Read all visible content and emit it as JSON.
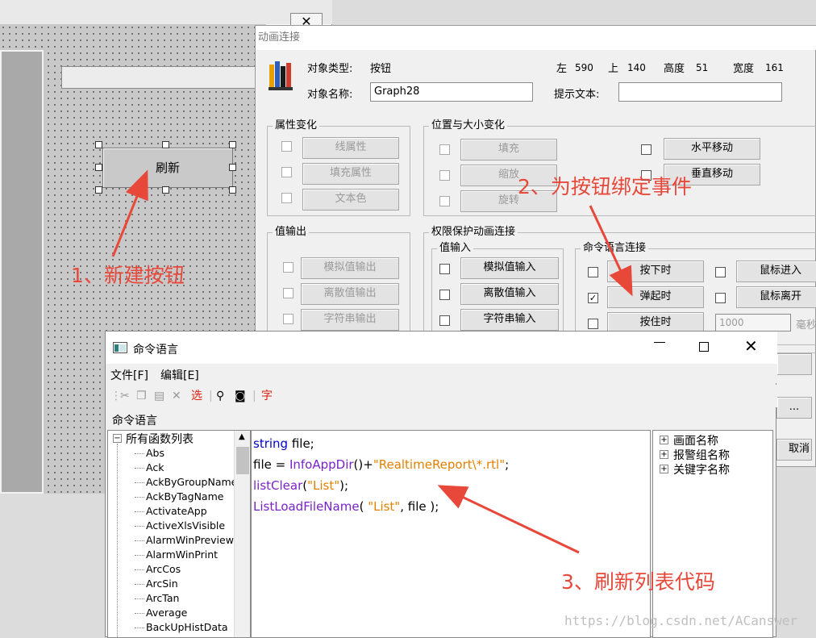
{
  "anim_dialog": {
    "title": "动画连接",
    "object_type_label": "对象类型:",
    "object_type_value": "按钮",
    "left_label": "左",
    "left_value": "590",
    "top_label": "上",
    "top_value": "140",
    "height_label": "高度",
    "height_value": "51",
    "width_label": "宽度",
    "width_value": "161",
    "object_name_label": "对象名称:",
    "object_name_value": "Graph28",
    "tooltip_label": "提示文本:",
    "tooltip_value": "",
    "attr_group": {
      "title": "属性变化",
      "line_attr": "线属性",
      "fill_attr": "填充属性",
      "text_color": "文本色"
    },
    "pos_group": {
      "title": "位置与大小变化",
      "fill": "填充",
      "scale": "缩放",
      "rotate": "旋转",
      "h_move": "水平移动",
      "v_move": "垂直移动"
    },
    "out_group": {
      "title": "值输出",
      "analog_out": "模拟值输出",
      "discrete_out": "离散值输出",
      "string_out": "字符串输出"
    },
    "perm_group": {
      "title": "权限保护动画连接"
    },
    "in_group": {
      "title": "值输入",
      "analog_in": "模拟值输入",
      "discrete_in": "离散值输入",
      "string_in": "字符串输入"
    },
    "cmd_group": {
      "title": "命令语言连接",
      "press": "按下时",
      "mouse_enter": "鼠标进入",
      "release": "弹起时",
      "mouse_leave": "鼠标离开",
      "hold": "按住时",
      "interval_value": "1000",
      "ms": "毫秒"
    },
    "extra_ellipsis": "...",
    "cancel_partial": "取消"
  },
  "canvas": {
    "refresh_button": "刷新"
  },
  "cmd_dialog": {
    "title": "命令语言",
    "menu_file": "文件[F]",
    "menu_edit": "编辑[E]",
    "toolbar_select": "选",
    "toolbar_font": "字",
    "section_label": "命令语言",
    "tree_root": "所有函数列表",
    "functions": [
      "Abs",
      "Ack",
      "AckByGroupName",
      "AckByTagName",
      "ActivateApp",
      "ActiveXlsVisible",
      "AlarmWinPreview",
      "AlarmWinPrint",
      "ArcCos",
      "ArcSin",
      "ArcTan",
      "Average",
      "BackUpHistData"
    ],
    "right_tree": [
      "画面名称",
      "报警组名称",
      "关键字名称"
    ],
    "code": {
      "l1_kw": "string",
      "l1_rest": " file;",
      "l2_a": "file = ",
      "l2_fn": "InfoAppDir",
      "l2_b": "()+",
      "l2_str": "\"RealtimeReport\\*.rtl\"",
      "l2_c": ";",
      "l3_fn": "listClear",
      "l3_a": "(",
      "l3_str": "\"List\"",
      "l3_b": ");",
      "l4_fn": "ListLoadFileName",
      "l4_a": "( ",
      "l4_str": "\"List\"",
      "l4_b": ", file );"
    }
  },
  "annotations": {
    "step1": "1、新建按钮",
    "step2": "2、为按钮绑定事件",
    "step3": "3、刷新列表代码"
  },
  "watermark": "https://blog.csdn.net/ACanswer"
}
